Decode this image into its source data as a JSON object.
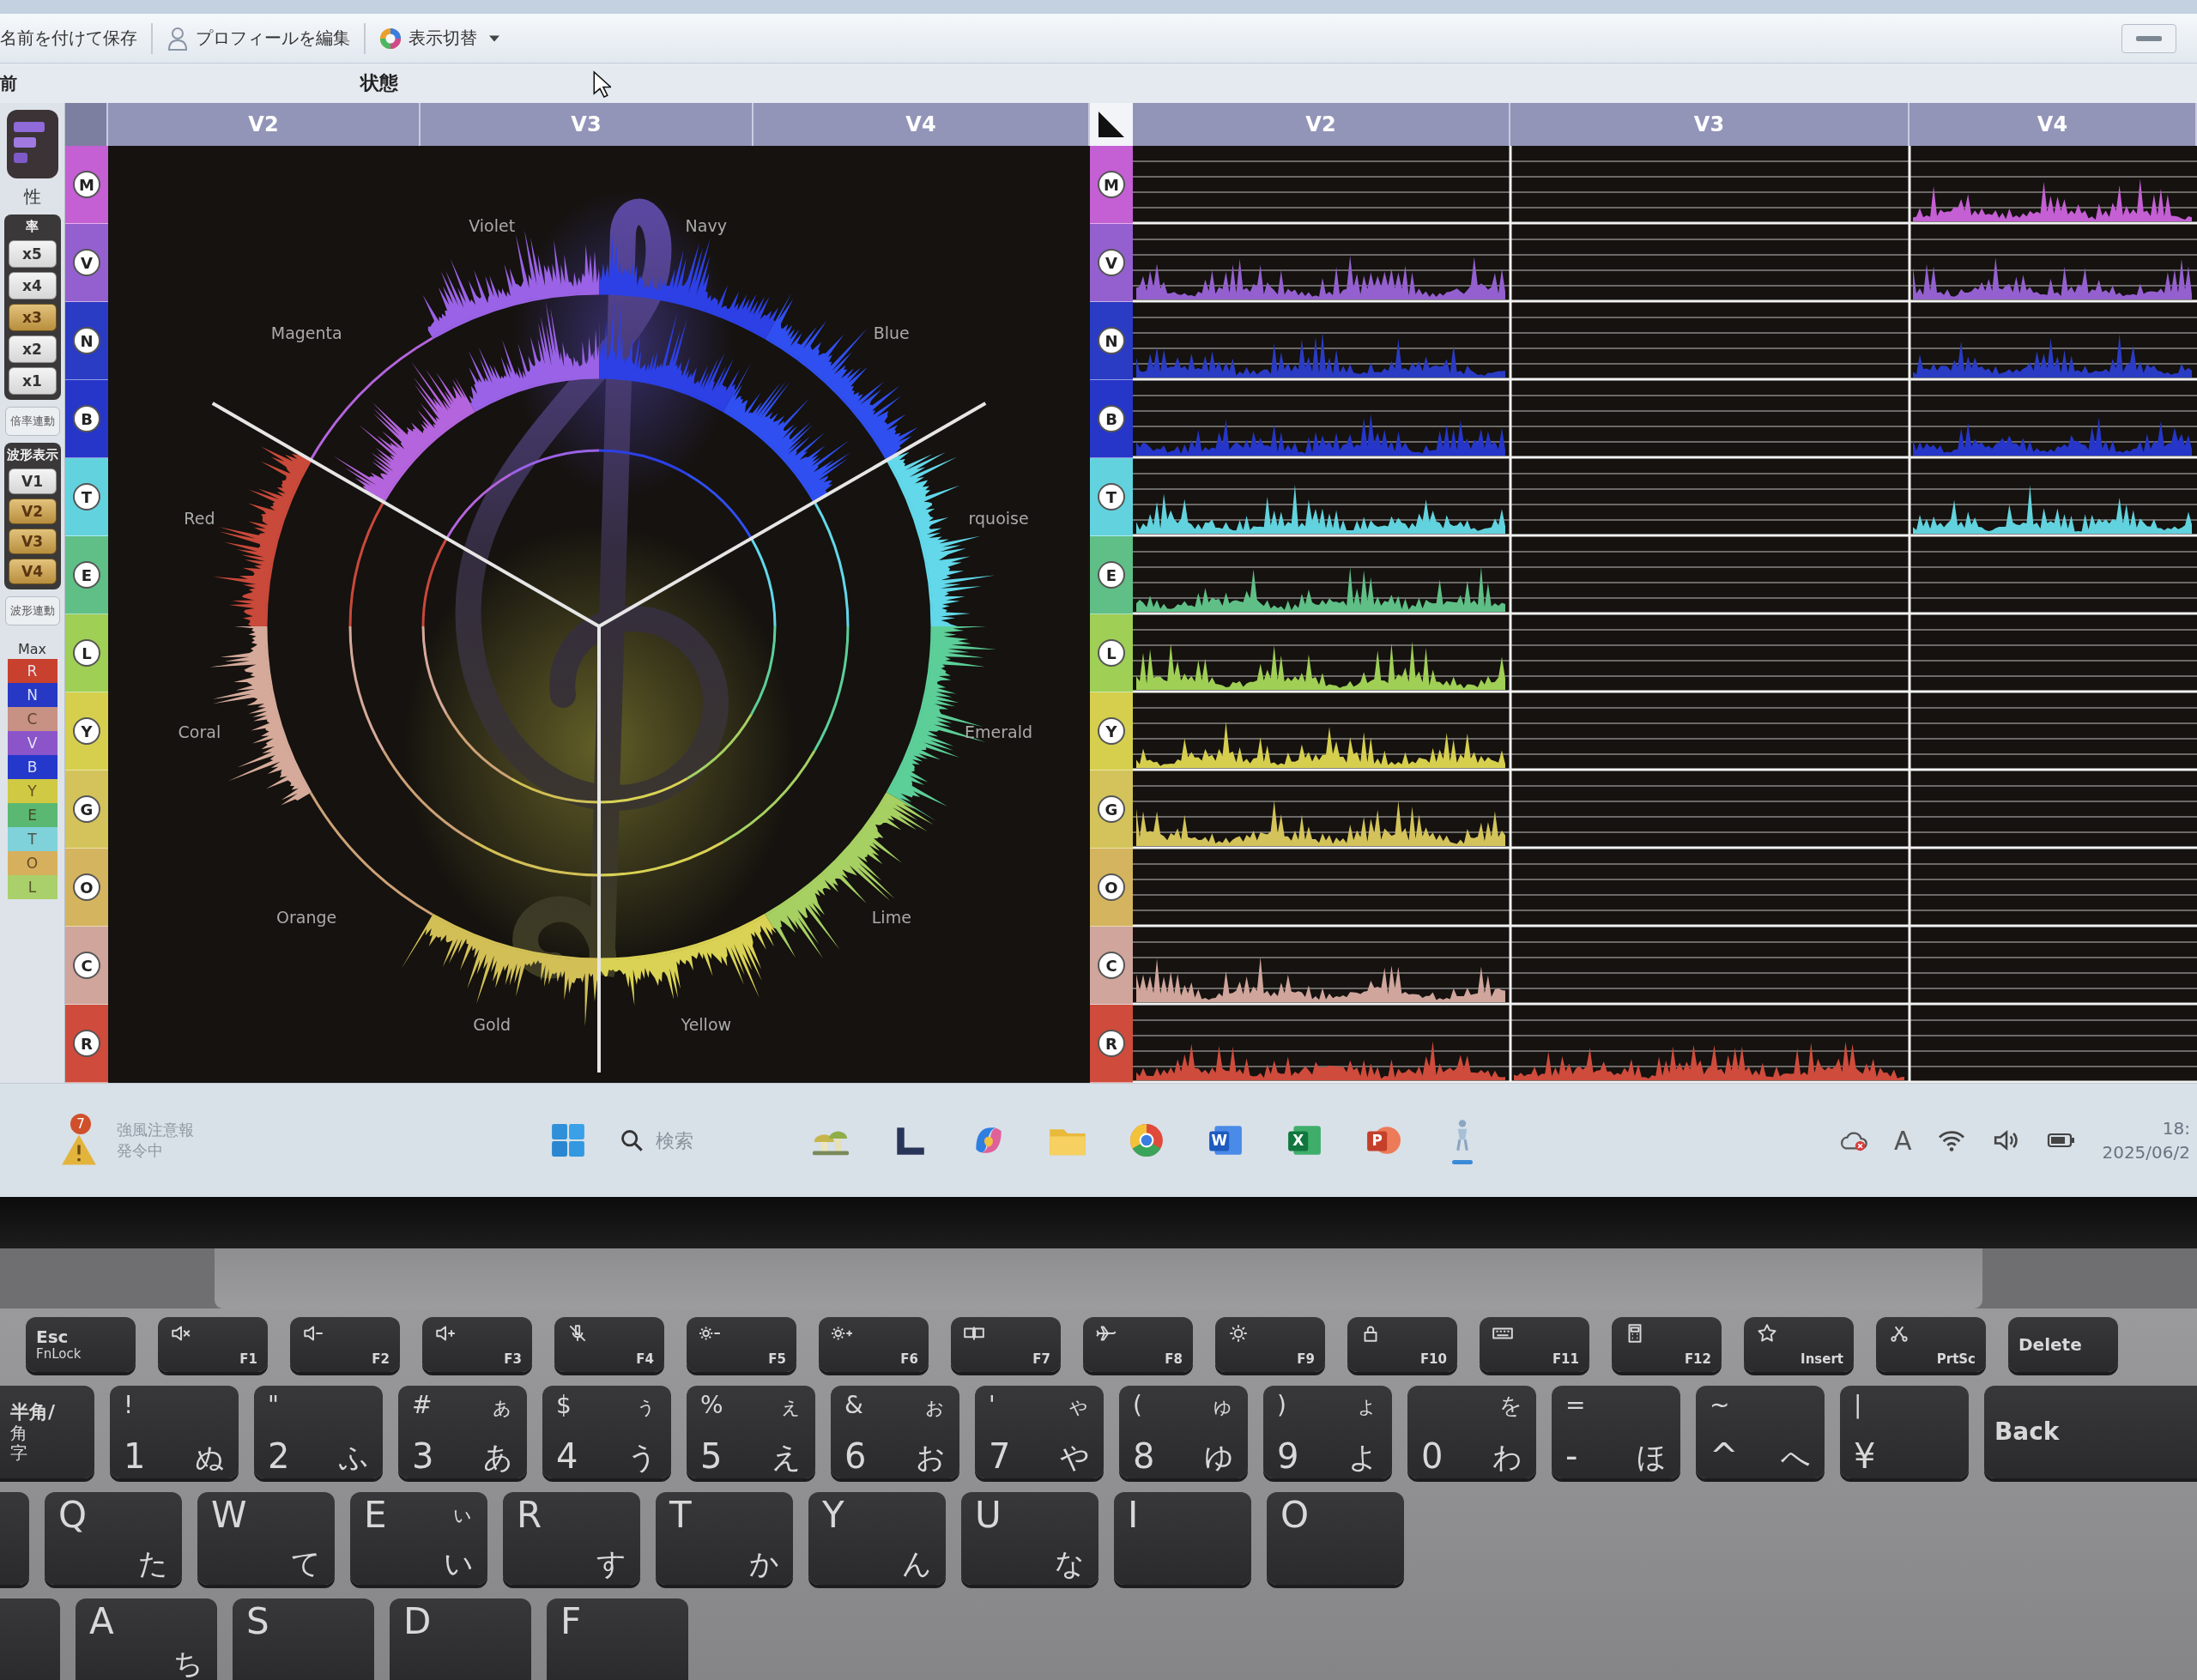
{
  "window": {
    "toolbar": [
      {
        "label": "名前を付けて保存",
        "kind": "plain"
      },
      {
        "label": "プロフィールを編集",
        "kind": "profile"
      },
      {
        "label": "表示切替",
        "kind": "menu"
      }
    ]
  },
  "header": {
    "column_label": "前",
    "title": "状態"
  },
  "sidebar": {
    "label": "性",
    "zoom": {
      "title": "率",
      "options": [
        {
          "label": "x5",
          "selected": false
        },
        {
          "label": "x4",
          "selected": false
        },
        {
          "label": "x3",
          "selected": true
        },
        {
          "label": "x2",
          "selected": false
        },
        {
          "label": "x1",
          "selected": false
        }
      ]
    },
    "zoom_link": "倍率連動",
    "waveform": {
      "title": "波形表示",
      "options": [
        {
          "label": "V1",
          "selected": false
        },
        {
          "label": "V2",
          "selected": true
        },
        {
          "label": "V3",
          "selected": true
        },
        {
          "label": "V4",
          "selected": true
        }
      ]
    },
    "waveform_link": "波形連動",
    "max_legend": {
      "title": "Max",
      "items": [
        {
          "letter": "R",
          "color": "#c8402e"
        },
        {
          "letter": "N",
          "color": "#2638c4"
        },
        {
          "letter": "C",
          "color": "#c79184"
        },
        {
          "letter": "V",
          "color": "#8b55c9"
        },
        {
          "letter": "B",
          "color": "#2538cc"
        },
        {
          "letter": "Y",
          "color": "#d0c944"
        },
        {
          "letter": "E",
          "color": "#5ab872"
        },
        {
          "letter": "T",
          "color": "#7fd2da"
        },
        {
          "letter": "O",
          "color": "#d7b05e"
        },
        {
          "letter": "L",
          "color": "#a9d06a"
        }
      ]
    }
  },
  "radial_view": {
    "tabs": [
      "V2",
      "V3",
      "V4"
    ],
    "channels": [
      {
        "letter": "M",
        "color": "#c45fd4"
      },
      {
        "letter": "V",
        "color": "#9460cf"
      },
      {
        "letter": "N",
        "color": "#2a3bc4"
      },
      {
        "letter": "B",
        "color": "#2536c9"
      },
      {
        "letter": "T",
        "color": "#62d3de"
      },
      {
        "letter": "E",
        "color": "#5fbf86"
      },
      {
        "letter": "L",
        "color": "#9fcf55"
      },
      {
        "letter": "Y",
        "color": "#d6cf4e"
      },
      {
        "letter": "G",
        "color": "#d3c35a"
      },
      {
        "letter": "O",
        "color": "#d4b45e"
      },
      {
        "letter": "C",
        "color": "#cfa59c"
      },
      {
        "letter": "R",
        "color": "#cf4b3c"
      }
    ],
    "sectors": [
      {
        "label": "Violet",
        "color": "#9a62e6",
        "outer": true,
        "inner": true
      },
      {
        "label": "Navy",
        "color": "#2c40e6",
        "outer": true,
        "inner": true
      },
      {
        "label": "Blue",
        "color": "#2f4ff0",
        "outer": true,
        "inner": true
      },
      {
        "label": "rquoise",
        "color": "#62d8ea",
        "outer": true,
        "inner": false
      },
      {
        "label": "Emerald",
        "color": "#5ccf98",
        "outer": true,
        "inner": false
      },
      {
        "label": "Lime",
        "color": "#a6d062",
        "outer": true,
        "inner": false
      },
      {
        "label": "Yellow",
        "color": "#d9d254",
        "outer": true,
        "inner": false
      },
      {
        "label": "Gold",
        "color": "#d2c056",
        "outer": true,
        "inner": false
      },
      {
        "label": "Orange",
        "color": "#cda276",
        "outer": false,
        "inner": false
      },
      {
        "label": "Coral",
        "color": "#d6aa9a",
        "outer": true,
        "inner": false
      },
      {
        "label": "Red",
        "color": "#c9493a",
        "outer": true,
        "inner": false
      },
      {
        "label": "Magenta",
        "color": "#b464dc",
        "outer": false,
        "inner": true
      }
    ]
  },
  "timeline_view": {
    "tabs": [
      "V2",
      "V3",
      "V4"
    ],
    "rows": [
      {
        "letter": "M",
        "color": "#c45fd4",
        "signal": [
          false,
          false,
          true
        ]
      },
      {
        "letter": "V",
        "color": "#9460cf",
        "signal": [
          true,
          false,
          true
        ]
      },
      {
        "letter": "N",
        "color": "#2a3bc4",
        "signal": [
          true,
          false,
          true
        ]
      },
      {
        "letter": "B",
        "color": "#2536c9",
        "signal": [
          true,
          false,
          true
        ]
      },
      {
        "letter": "T",
        "color": "#62d3de",
        "signal": [
          true,
          false,
          true
        ]
      },
      {
        "letter": "E",
        "color": "#5fbf86",
        "signal": [
          true,
          false,
          false
        ]
      },
      {
        "letter": "L",
        "color": "#9fcf55",
        "signal": [
          true,
          false,
          false
        ]
      },
      {
        "letter": "Y",
        "color": "#d6cf4e",
        "signal": [
          true,
          false,
          false
        ]
      },
      {
        "letter": "G",
        "color": "#d3c35a",
        "signal": [
          true,
          false,
          false
        ]
      },
      {
        "letter": "O",
        "color": "#d4b45e",
        "signal": [
          false,
          false,
          false
        ]
      },
      {
        "letter": "C",
        "color": "#cfa59c",
        "signal": [
          true,
          false,
          false
        ]
      },
      {
        "letter": "R",
        "color": "#cf4b3c",
        "signal": [
          true,
          true,
          false
        ]
      }
    ]
  },
  "taskbar": {
    "weather": {
      "badge": "7",
      "title": "強風注意報",
      "subtitle": "発令中"
    },
    "search": {
      "placeholder": "検索"
    },
    "apps": [
      {
        "kind": "widgets",
        "running": false
      },
      {
        "kind": "bracket",
        "running": false
      },
      {
        "kind": "copilot",
        "running": false
      },
      {
        "kind": "folder",
        "running": false
      },
      {
        "kind": "chrome",
        "running": false
      },
      {
        "kind": "word",
        "letter": "W",
        "running": false
      },
      {
        "kind": "excel",
        "letter": "X",
        "running": false
      },
      {
        "kind": "powerpoint",
        "letter": "P",
        "running": false
      },
      {
        "kind": "figure",
        "running": true
      }
    ],
    "tray": {
      "ime": "A"
    },
    "clock": {
      "time": "18:",
      "date": "2025/06/2"
    }
  },
  "keyboard": {
    "rows": [
      {
        "keys": [
          {
            "kind": "text",
            "lines": [
              "Esc",
              "FnLock"
            ]
          },
          {
            "kind": "mute",
            "label": "F1"
          },
          {
            "kind": "voldown",
            "label": "F2"
          },
          {
            "kind": "volup",
            "label": "F3"
          },
          {
            "kind": "micoff",
            "label": "F4"
          },
          {
            "kind": "dimmer",
            "label": "F5"
          },
          {
            "kind": "brighter",
            "label": "F6"
          },
          {
            "kind": "display",
            "label": "F7"
          },
          {
            "kind": "airplane",
            "label": "F8"
          },
          {
            "kind": "gear",
            "label": "F9"
          },
          {
            "kind": "lock",
            "label": "F10"
          },
          {
            "kind": "keyboard",
            "label": "F11"
          },
          {
            "kind": "calculator",
            "label": "F12"
          },
          {
            "kind": "star",
            "label": "Insert"
          },
          {
            "kind": "snip",
            "label": "PrtSc"
          },
          {
            "kind": "text",
            "lines": [
              "Delete"
            ]
          }
        ]
      },
      {
        "keys": [
          {
            "kind": "text",
            "lines": [
              "半角/",
              "角",
              "字"
            ]
          },
          {
            "kind": "jis",
            "shift": "!",
            "main": "1",
            "kana": "ぬ"
          },
          {
            "kind": "jis",
            "shift": "\"",
            "main": "2",
            "kana": "ふ"
          },
          {
            "kind": "jis",
            "shift": "#",
            "main": "3",
            "kana_small": "ぁ",
            "kana": "あ"
          },
          {
            "kind": "jis",
            "shift": "$",
            "main": "4",
            "kana_small": "ぅ",
            "kana": "う"
          },
          {
            "kind": "jis",
            "shift": "%",
            "main": "5",
            "kana_small": "ぇ",
            "kana": "え"
          },
          {
            "kind": "jis",
            "shift": "&",
            "main": "6",
            "kana_small": "ぉ",
            "kana": "お"
          },
          {
            "kind": "jis",
            "shift": "'",
            "main": "7",
            "kana_small": "ゃ",
            "kana": "や"
          },
          {
            "kind": "jis",
            "shift": "(",
            "main": "8",
            "kana_small": "ゅ",
            "kana": "ゆ"
          },
          {
            "kind": "jis",
            "shift": ")",
            "main": "9",
            "kana_small": "ょ",
            "kana": "よ"
          },
          {
            "kind": "jis",
            "main": "0",
            "kana_small": "を",
            "kana": "わ"
          },
          {
            "kind": "jis",
            "shift": "=",
            "main": "-",
            "kana": "ほ"
          },
          {
            "kind": "jis",
            "shift": "~",
            "main": "^",
            "kana": "へ"
          },
          {
            "kind": "jis",
            "shift": "|",
            "main": "¥"
          },
          {
            "kind": "text",
            "lines": [
              "Back"
            ]
          }
        ]
      },
      {
        "keys": [
          {
            "kind": "blank"
          },
          {
            "kind": "letter",
            "main": "Q",
            "kana": "た"
          },
          {
            "kind": "letter",
            "main": "W",
            "kana": "て"
          },
          {
            "kind": "letter",
            "main": "E",
            "kana_small": "ぃ",
            "kana": "い"
          },
          {
            "kind": "letter",
            "main": "R",
            "kana": "す"
          },
          {
            "kind": "letter",
            "main": "T",
            "kana": "か"
          },
          {
            "kind": "letter",
            "main": "Y",
            "kana": "ん"
          },
          {
            "kind": "letter",
            "main": "U",
            "kana": "な"
          },
          {
            "kind": "letter",
            "main": "I"
          },
          {
            "kind": "letter",
            "main": "O"
          }
        ]
      },
      {
        "keys": [
          {
            "kind": "blank"
          },
          {
            "kind": "letter",
            "main": "A",
            "kana": "ち"
          },
          {
            "kind": "letter",
            "main": "S"
          },
          {
            "kind": "letter",
            "main": "D"
          },
          {
            "kind": "letter",
            "main": "F"
          }
        ]
      }
    ]
  }
}
